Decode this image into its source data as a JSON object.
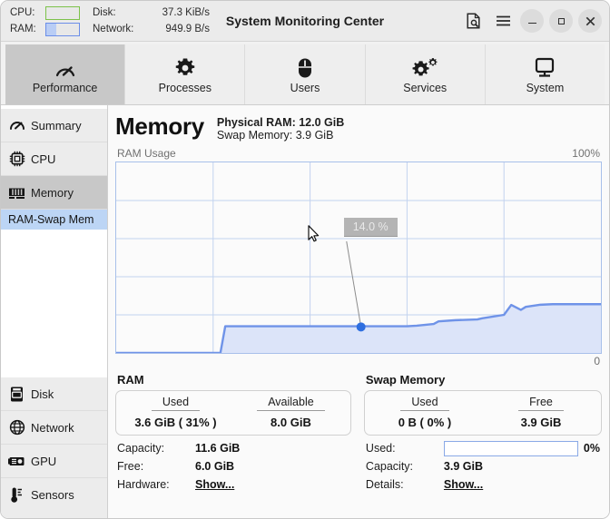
{
  "window": {
    "title": "System Monitoring Center",
    "mini_stats": {
      "cpu_label": "CPU:",
      "ram_label": "RAM:",
      "cpu_percent": 0,
      "ram_percent": 31,
      "cpu_border_color": "#7cc24a",
      "ram_border_color": "#6b8ee8",
      "disk_label": "Disk:",
      "disk_value": "37.3 KiB/s",
      "network_label": "Network:",
      "network_value": "949.9 B/s"
    },
    "controls": {
      "document_search": "document-search-icon",
      "menu": "hamburger-menu-icon",
      "minimize": "minimize-icon",
      "maximize": "maximize-icon",
      "close": "close-icon"
    }
  },
  "tabs": [
    {
      "label": "Performance",
      "icon": "speedometer-icon",
      "active": true
    },
    {
      "label": "Processes",
      "icon": "gear-icon",
      "active": false
    },
    {
      "label": "Users",
      "icon": "mouse-icon",
      "active": false
    },
    {
      "label": "Services",
      "icon": "gears-icon",
      "active": false
    },
    {
      "label": "System",
      "icon": "monitor-icon",
      "active": false
    }
  ],
  "sidebar": {
    "top_items": [
      {
        "label": "Summary",
        "icon": "speedometer-icon",
        "active": false
      },
      {
        "label": "CPU",
        "icon": "cpu-chip-icon",
        "active": false
      },
      {
        "label": "Memory",
        "icon": "ram-stick-icon",
        "active": true
      }
    ],
    "sub_item": {
      "label": "RAM-Swap Mem",
      "selected": true
    },
    "bottom_items": [
      {
        "label": "Disk",
        "icon": "hard-drive-icon",
        "active": false
      },
      {
        "label": "Network",
        "icon": "globe-icon",
        "active": false
      },
      {
        "label": "GPU",
        "icon": "gpu-card-icon",
        "active": false
      },
      {
        "label": "Sensors",
        "icon": "thermometer-icon",
        "active": false
      }
    ]
  },
  "main": {
    "page_title": "Memory",
    "physical_ram": "Physical RAM: 12.0 GiB",
    "swap_memory": "Swap Memory: 3.9 GiB"
  },
  "chart_data": {
    "type": "area",
    "title": "RAM Usage",
    "ylabel": "",
    "xlabel": "",
    "ylim": [
      0,
      100
    ],
    "y_top_label": "100%",
    "y_bottom_label": "0",
    "grid": true,
    "line_color": "#6f93e8",
    "fill_color": "#dce4f9",
    "tooltip": {
      "text": "14.0 %",
      "x_ratio": 0.505,
      "y_value": 14.0
    },
    "marker": {
      "x_ratio": 0.505,
      "y_value": 14.0,
      "color": "#2f6fe0"
    },
    "series": [
      {
        "name": "RAM Usage",
        "x": [
          0.0,
          0.215,
          0.225,
          0.5,
          0.6,
          0.62,
          0.655,
          0.665,
          0.7,
          0.745,
          0.755,
          0.8,
          0.815,
          0.835,
          0.845,
          0.875,
          0.9,
          1.0
        ],
        "values": [
          0.0,
          0.0,
          14.0,
          14.0,
          14.0,
          14.3,
          15.2,
          16.6,
          17.2,
          17.6,
          18.2,
          20.0,
          25.2,
          22.6,
          24.2,
          25.3,
          25.6,
          25.6
        ]
      }
    ]
  },
  "ram_panel": {
    "title": "RAM",
    "card": [
      {
        "header": "Used",
        "value": "3.6 GiB  ( 31% )"
      },
      {
        "header": "Available",
        "value": "8.0 GiB"
      }
    ],
    "rows": [
      {
        "key": "Capacity:",
        "value": "11.6 GiB",
        "type": "text"
      },
      {
        "key": "Free:",
        "value": "6.0 GiB",
        "type": "text"
      },
      {
        "key": "Hardware:",
        "value": "Show...",
        "type": "link"
      }
    ]
  },
  "swap_panel": {
    "title": "Swap Memory",
    "card": [
      {
        "header": "Used",
        "value": "0 B  ( 0% )"
      },
      {
        "header": "Free",
        "value": "3.9 GiB"
      }
    ],
    "used_row": {
      "key": "Used:",
      "percent": 0,
      "percent_label": "0%"
    },
    "rows": [
      {
        "key": "Capacity:",
        "value": "3.9 GiB",
        "type": "text"
      },
      {
        "key": "Details:",
        "value": "Show...",
        "type": "link"
      }
    ]
  }
}
